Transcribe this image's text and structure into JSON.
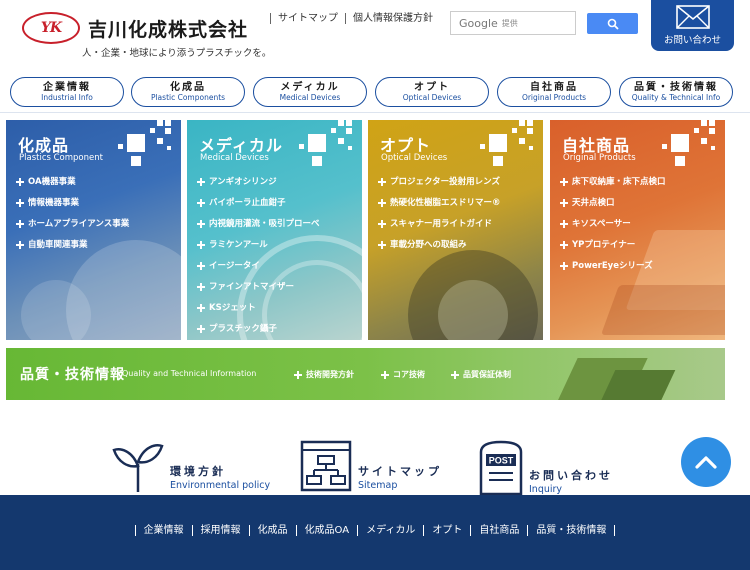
{
  "header": {
    "logo_mark": "YK",
    "company_name": "吉川化成株式会社",
    "tagline": "人・企業・地球により添うプラスチックを。",
    "top_links": [
      "サイトマップ",
      "個人情報保護方針"
    ],
    "search": {
      "brand": "Google",
      "label": "提供"
    },
    "contact_label": "お問い合わせ"
  },
  "nav": [
    {
      "jp": "企業情報",
      "en": "Industrial Info"
    },
    {
      "jp": "化成品",
      "en": "Plastic Components"
    },
    {
      "jp": "メディカル",
      "en": "Medical Devices"
    },
    {
      "jp": "オプト",
      "en": "Optical Devices"
    },
    {
      "jp": "自社商品",
      "en": "Original Products"
    },
    {
      "jp": "品質・技術情報",
      "en": "Quality & Technical Info"
    }
  ],
  "tiles": [
    {
      "title": "化成品",
      "sub": "Plastics Component",
      "items": [
        "OA機器事業",
        "情報機器事業",
        "ホームアプライアンス事業",
        "自動車関連事業"
      ]
    },
    {
      "title": "メディカル",
      "sub": "Medical Devices",
      "items": [
        "アンギオシリンジ",
        "バイポーラ止血鉗子",
        "内視鏡用灌流・吸引プローベ",
        "ラミケンアール",
        "イージータイ",
        "ファインアトマイザー",
        "KSジェット",
        "プラスチック鑷子"
      ]
    },
    {
      "title": "オプト",
      "sub": "Optical Devices",
      "items": [
        "プロジェクター投射用レンズ",
        "熱硬化性樹脂エスドリマー®",
        "スキャナー用ライトガイド",
        "車載分野への取組み"
      ]
    },
    {
      "title": "自社商品",
      "sub": "Original Products",
      "items": [
        "床下収納庫・床下点検口",
        "天井点検口",
        "キソスペーサー",
        "YPプロテイナー",
        "PowerEyeシリーズ"
      ]
    }
  ],
  "quality": {
    "title": "品質・技術情報",
    "en": "Quality and Technical Information",
    "links": [
      "技術開発方針",
      "コア技術",
      "品質保証体制"
    ]
  },
  "bottom_links": [
    {
      "jp": "環境方針",
      "en": "Environmental policy",
      "icon": "sprout-icon"
    },
    {
      "jp": "サイトマップ",
      "en": "Sitemap",
      "icon": "sitemap-icon"
    },
    {
      "jp": "お問い合わせ",
      "en": "Inquiry",
      "icon": "post-box-icon"
    }
  ],
  "footer_links": [
    "企業情報",
    "採用情報",
    "化成品",
    "化成品OA",
    "メディカル",
    "オプト",
    "自社商品",
    "品質・技術情報"
  ],
  "colors": {
    "brand_blue": "#1b4fa0",
    "footer": "#14386e",
    "logo_red": "#c8202b"
  }
}
